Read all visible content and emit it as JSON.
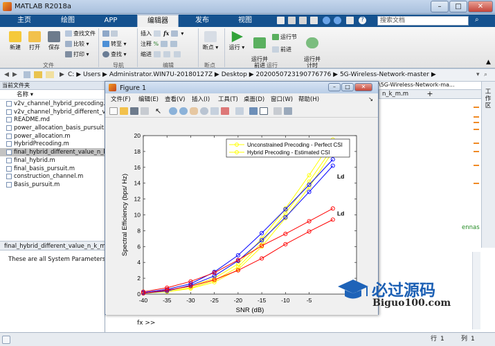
{
  "app": {
    "window_title": "MATLAB R2018a"
  },
  "ribbon": {
    "tabs": [
      "主页",
      "绘图",
      "APP",
      "编辑器",
      "发布",
      "视图"
    ],
    "active_tab": "编辑器",
    "search_placeholder": "搜索文档",
    "groups": {
      "file": "文件",
      "navigate": "导航",
      "edit": "编辑",
      "breakpoints": "断点",
      "run": "运行"
    },
    "buttons": {
      "new": "新建",
      "open": "打开",
      "save": "保存",
      "find_files": "查找文件",
      "compare": "比较",
      "print": "打印",
      "goto": "转至",
      "find": "查找",
      "insert": "插入",
      "comment": "注释",
      "indent": "缩进",
      "fx": "fx",
      "breakpoints": "断点",
      "run": "运行",
      "run_advance": "运行并\n前进",
      "run_section": "运行节",
      "advance": "前进",
      "run_time": "运行并\n计时"
    }
  },
  "address": {
    "parts": [
      "C:",
      "Users",
      "Administrator.WIN7U-20180127Z",
      "Desktop",
      "2020050723190776776",
      "5G-Wireless-Network-master"
    ]
  },
  "current_folder": {
    "title": "当前文件夹",
    "column_name": "名称",
    "files": [
      "v2v_channel_hybrid_precoding.m",
      "v2v_channel_hybrid_different_value.m",
      "README.md",
      "power_allocation_basis_pursuit.m",
      "power_allocation.m",
      "HybridPrecoding.m",
      "final_hybrid_different_value_n_k_m.m",
      "final_hybrid.m",
      "final_basis_pursuit.m",
      "construction_channel.m",
      "Basis_pursuit.m"
    ],
    "selected": "final_hybrid_different_value_n_k_m.m",
    "details_title": "final_hybrid_different_value_n_k_m.m",
    "details_text": "These are all System Parameters%"
  },
  "editor": {
    "tab_label": "n_k_m.m",
    "path_hint": "\\5G-Wireless-Network-ma...",
    "code_snippet": "ennas",
    "workspace_label": "工作区"
  },
  "command": {
    "prompt": "fx >>"
  },
  "status": {
    "line_label": "行",
    "line_value": "1",
    "col_label": "列",
    "col_value": "1"
  },
  "figure": {
    "title": "Figure 1",
    "menu": [
      "文件(F)",
      "编辑(E)",
      "查看(V)",
      "插入(I)",
      "工具(T)",
      "桌面(D)",
      "窗口(W)",
      "帮助(H)"
    ]
  },
  "watermark": {
    "cn": "必过源码",
    "en": "Biguo100.com"
  },
  "chart_data": {
    "type": "line",
    "xlabel": "SNR (dB)",
    "ylabel": "Spectral Efficiency (bps/ Hz)",
    "xlim": [
      -40,
      5
    ],
    "ylim": [
      0,
      20
    ],
    "x_ticks": [
      -40,
      -35,
      -30,
      -25,
      -20,
      -15,
      -10,
      -5
    ],
    "y_ticks": [
      0,
      2,
      4,
      6,
      8,
      10,
      12,
      14,
      16,
      18,
      20
    ],
    "grid": false,
    "legend_position": "top-right",
    "legend": [
      {
        "name": "Unconstrained Precoding - Perfect CSI",
        "color": "#ffff00"
      },
      {
        "name": "Hybrid Precoding - Estimated CSI",
        "color": "#ffff00"
      }
    ],
    "annotations": [
      {
        "text": "Ld",
        "x": 0.9,
        "y": 14.6
      },
      {
        "text": "Ld",
        "x": 0.9,
        "y": 9.9
      }
    ],
    "series": [
      {
        "color": "#ffff00",
        "x": [
          -40,
          -35,
          -30,
          -25,
          -20,
          -15,
          -10,
          -5,
          0
        ],
        "y": [
          0.1,
          0.4,
          1.0,
          2.0,
          3.8,
          7.0,
          10.8,
          15.0,
          19.5
        ]
      },
      {
        "color": "#ffff00",
        "x": [
          -40,
          -35,
          -30,
          -25,
          -20,
          -15,
          -10,
          -5,
          0
        ],
        "y": [
          0.1,
          0.3,
          0.8,
          1.7,
          3.4,
          6.5,
          10.2,
          14.2,
          18.5
        ]
      },
      {
        "color": "#ffff00",
        "x": [
          -40,
          -35,
          -30,
          -25,
          -20,
          -15,
          -10,
          -5,
          0
        ],
        "y": [
          0.1,
          0.3,
          0.7,
          1.5,
          3.1,
          6.0,
          9.6,
          13.5,
          18.0
        ]
      },
      {
        "color": "#0000ff",
        "x": [
          -40,
          -35,
          -30,
          -25,
          -20,
          -15,
          -10,
          -5,
          0
        ],
        "y": [
          0.2,
          0.6,
          1.3,
          2.8,
          4.9,
          7.7,
          10.7,
          13.8,
          17.0
        ]
      },
      {
        "color": "#0000ff",
        "x": [
          -40,
          -35,
          -30,
          -25,
          -20,
          -15,
          -10,
          -5,
          0
        ],
        "y": [
          0.1,
          0.4,
          1.1,
          2.3,
          4.2,
          6.8,
          9.7,
          12.9,
          16.2
        ]
      },
      {
        "color": "#ff0000",
        "x": [
          -40,
          -35,
          -30,
          -25,
          -20,
          -15,
          -10,
          -5,
          0
        ],
        "y": [
          0.3,
          0.8,
          1.6,
          2.7,
          4.3,
          6.1,
          7.6,
          9.2,
          10.8
        ]
      },
      {
        "color": "#ff0000",
        "x": [
          -40,
          -35,
          -30,
          -25,
          -20,
          -15,
          -10,
          -5,
          0
        ],
        "y": [
          0.1,
          0.5,
          1.0,
          1.8,
          3.0,
          4.5,
          6.3,
          7.9,
          9.4
        ]
      }
    ]
  }
}
